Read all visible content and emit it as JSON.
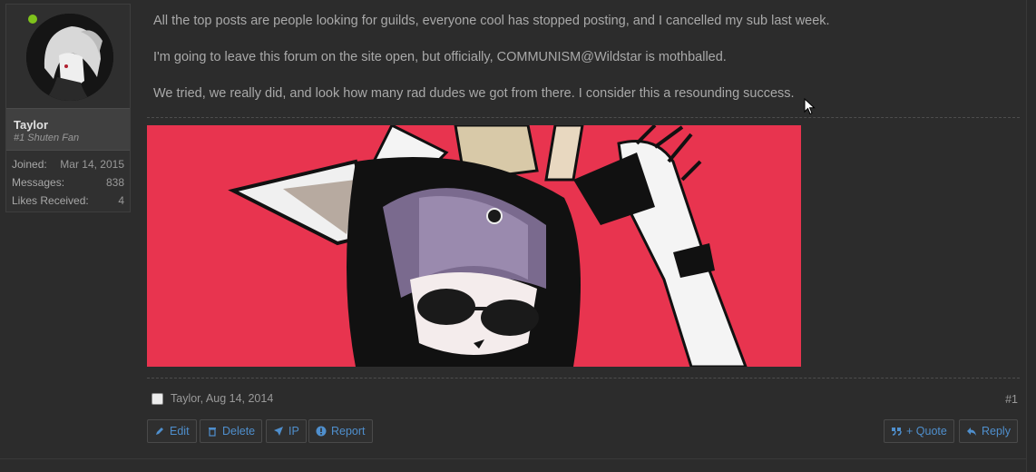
{
  "user": {
    "name": "Taylor",
    "title": "#1 Shuten Fan",
    "online_color": "#7fc31c",
    "stats": [
      {
        "label": "Joined:",
        "value": "Mar 14, 2015"
      },
      {
        "label": "Messages:",
        "value": "838"
      },
      {
        "label": "Likes Received:",
        "value": "4"
      }
    ]
  },
  "post": {
    "lines": [
      "All the top posts are people looking for guilds, everyone cool has stopped posting, and I cancelled my sub last week.",
      "I'm going to leave this forum on the site open, but officially, COMMUNISM@Wildstar is mothballed.",
      "We tried, we really did, and look how many rad dudes we got from there. I consider this a resounding success."
    ],
    "author_date": "Taylor, Aug 14, 2014",
    "number": "#1",
    "image_bg": "#e8344f"
  },
  "actions": {
    "edit": "Edit",
    "delete": "Delete",
    "ip": "IP",
    "report": "Report",
    "quote": "+ Quote",
    "reply": "Reply"
  },
  "colors": {
    "link": "#4f8fcd",
    "background": "#2c2c2c"
  }
}
